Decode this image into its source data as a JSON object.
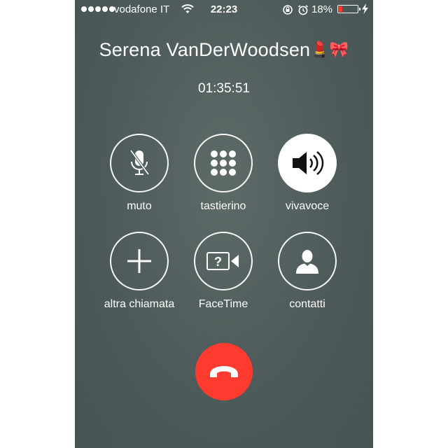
{
  "status_bar": {
    "signal_bars": 5,
    "carrier": "vodafone IT",
    "time": "22:23",
    "battery_percent": "18%",
    "battery_level": 0.18,
    "icons": [
      "wifi-icon",
      "rotation-lock-icon",
      "alarm-icon",
      "battery-icon",
      "charging-bolt-icon"
    ]
  },
  "call": {
    "caller_name": "Serena VanDerWoodsen",
    "caller_emoji": "💄🎀",
    "duration": "01:35:51"
  },
  "controls": [
    {
      "label": "muto",
      "icon": "microphone-muted-icon",
      "active": false
    },
    {
      "label": "tastierino",
      "icon": "keypad-icon",
      "active": false
    },
    {
      "label": "vivavoce",
      "icon": "speaker-icon",
      "active": true
    },
    {
      "label": "altra chiamata",
      "icon": "plus-icon",
      "active": false
    },
    {
      "label": "FaceTime",
      "icon": "facetime-icon",
      "active": false
    },
    {
      "label": "contatti",
      "icon": "contact-icon",
      "active": false
    }
  ],
  "end_call": {
    "icon": "phone-hangup-icon",
    "color": "#ff3b30"
  },
  "colors": {
    "background": "#4e5b5a",
    "end_call_red": "#ff3b30",
    "active_button": "#ffffff",
    "battery_low": "#ff3b30"
  }
}
